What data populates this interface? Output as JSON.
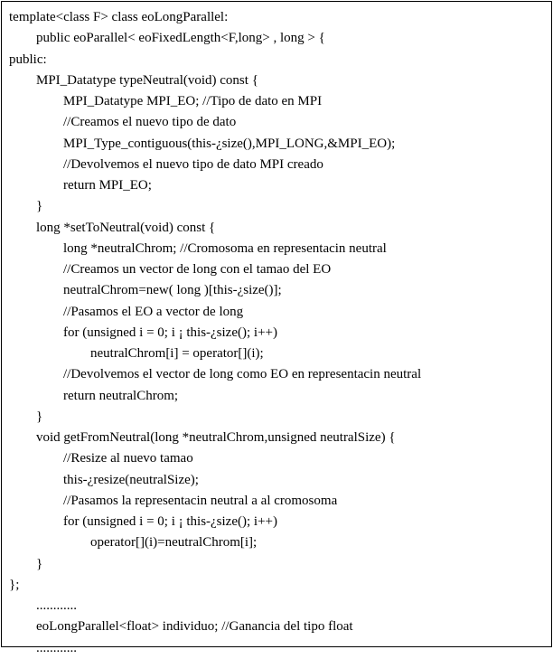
{
  "code": {
    "l01": "template<class F> class eoLongParallel:",
    "l02": "public eoParallel< eoFixedLength<F,long> , long > {",
    "l03": "public:",
    "l04": "MPI_Datatype typeNeutral(void) const {",
    "l05": "MPI_Datatype MPI_EO; //Tipo de dato en MPI",
    "l06": "//Creamos el nuevo tipo de dato",
    "l07": "MPI_Type_contiguous(this-¿size(),MPI_LONG,&MPI_EO);",
    "l08": "//Devolvemos el nuevo tipo de dato MPI creado",
    "l09": "return MPI_EO;",
    "l10": "}",
    "l11": "long *setToNeutral(void) const {",
    "l12": "long *neutralChrom; //Cromosoma en representacin neutral",
    "l13": "//Creamos un vector de long con el tamao del EO",
    "l14": "neutralChrom=new( long )[this-¿size()];",
    "l15": "//Pasamos el EO a vector de long",
    "l16": "for (unsigned i = 0; i ¡ this-¿size(); i++)",
    "l17": "neutralChrom[i] = operator[](i);",
    "l18": "//Devolvemos el vector de long como EO en representacin neutral",
    "l19": "return neutralChrom;",
    "l20": "}",
    "l21": "void getFromNeutral(long *neutralChrom,unsigned neutralSize) {",
    "l22": "//Resize al nuevo tamao",
    "l23": "this-¿resize(neutralSize);",
    "l24": "//Pasamos la representacin neutral a al cromosoma",
    "l25": "for (unsigned i = 0; i ¡ this-¿size(); i++)",
    "l26": "operator[](i)=neutralChrom[i];",
    "l27": "}",
    "l28": "};",
    "l29": "............",
    "l30": "eoLongParallel<float> individuo; //Ganancia del tipo float",
    "l31": "............"
  }
}
